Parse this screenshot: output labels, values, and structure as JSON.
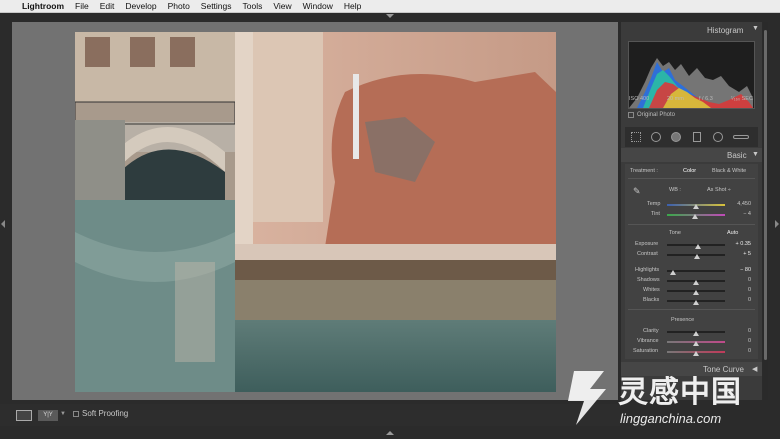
{
  "menubar": {
    "app": "Lightroom",
    "items": [
      "File",
      "Edit",
      "Develop",
      "Photo",
      "Settings",
      "Tools",
      "View",
      "Window",
      "Help"
    ]
  },
  "histogram": {
    "title": "Histogram",
    "iso": "ISO 400",
    "focal": "20 mm",
    "aperture": "f / 6.3",
    "shutter": "¹⁄₁₆₀ SEC",
    "original_photo": "Original Photo"
  },
  "basic": {
    "title": "Basic",
    "treatment_label": "Treatment :",
    "treatment_color": "Color",
    "treatment_bw": "Black & White",
    "wb_label": "WB :",
    "wb_value": "As Shot ÷",
    "temp_label": "Temp",
    "temp_value": "4,450",
    "tint_label": "Tint",
    "tint_value": "− 4",
    "tone_label": "Tone",
    "auto_label": "Auto",
    "exposure_label": "Exposure",
    "exposure_value": "+ 0.35",
    "contrast_label": "Contrast",
    "contrast_value": "+ 5",
    "highlights_label": "Highlights",
    "highlights_value": "− 80",
    "shadows_label": "Shadows",
    "shadows_value": "0",
    "whites_label": "Whites",
    "whites_value": "0",
    "blacks_label": "Blacks",
    "blacks_value": "0",
    "presence_label": "Presence",
    "clarity_label": "Clarity",
    "clarity_value": "0",
    "vibrance_label": "Vibrance",
    "vibrance_value": "0",
    "saturation_label": "Saturation",
    "saturation_value": "0"
  },
  "tone_curve": {
    "title": "Tone Curve"
  },
  "bottom": {
    "yy_label": "Y|Y",
    "soft_proofing": "Soft Proofing"
  },
  "watermark": {
    "cn": "灵感中国",
    "url": "lingganchina.com"
  },
  "sliders": {
    "temp": 0.5,
    "tint": 0.49,
    "exposure": 0.53,
    "contrast": 0.51,
    "highlights": 0.1,
    "shadows": 0.5,
    "whites": 0.5,
    "blacks": 0.5,
    "clarity": 0.5,
    "vibrance": 0.5,
    "saturation": 0.5
  },
  "colors": {
    "accent": "#e0e0e0",
    "panel": "#3b3b3b",
    "canvas": "#727272"
  }
}
